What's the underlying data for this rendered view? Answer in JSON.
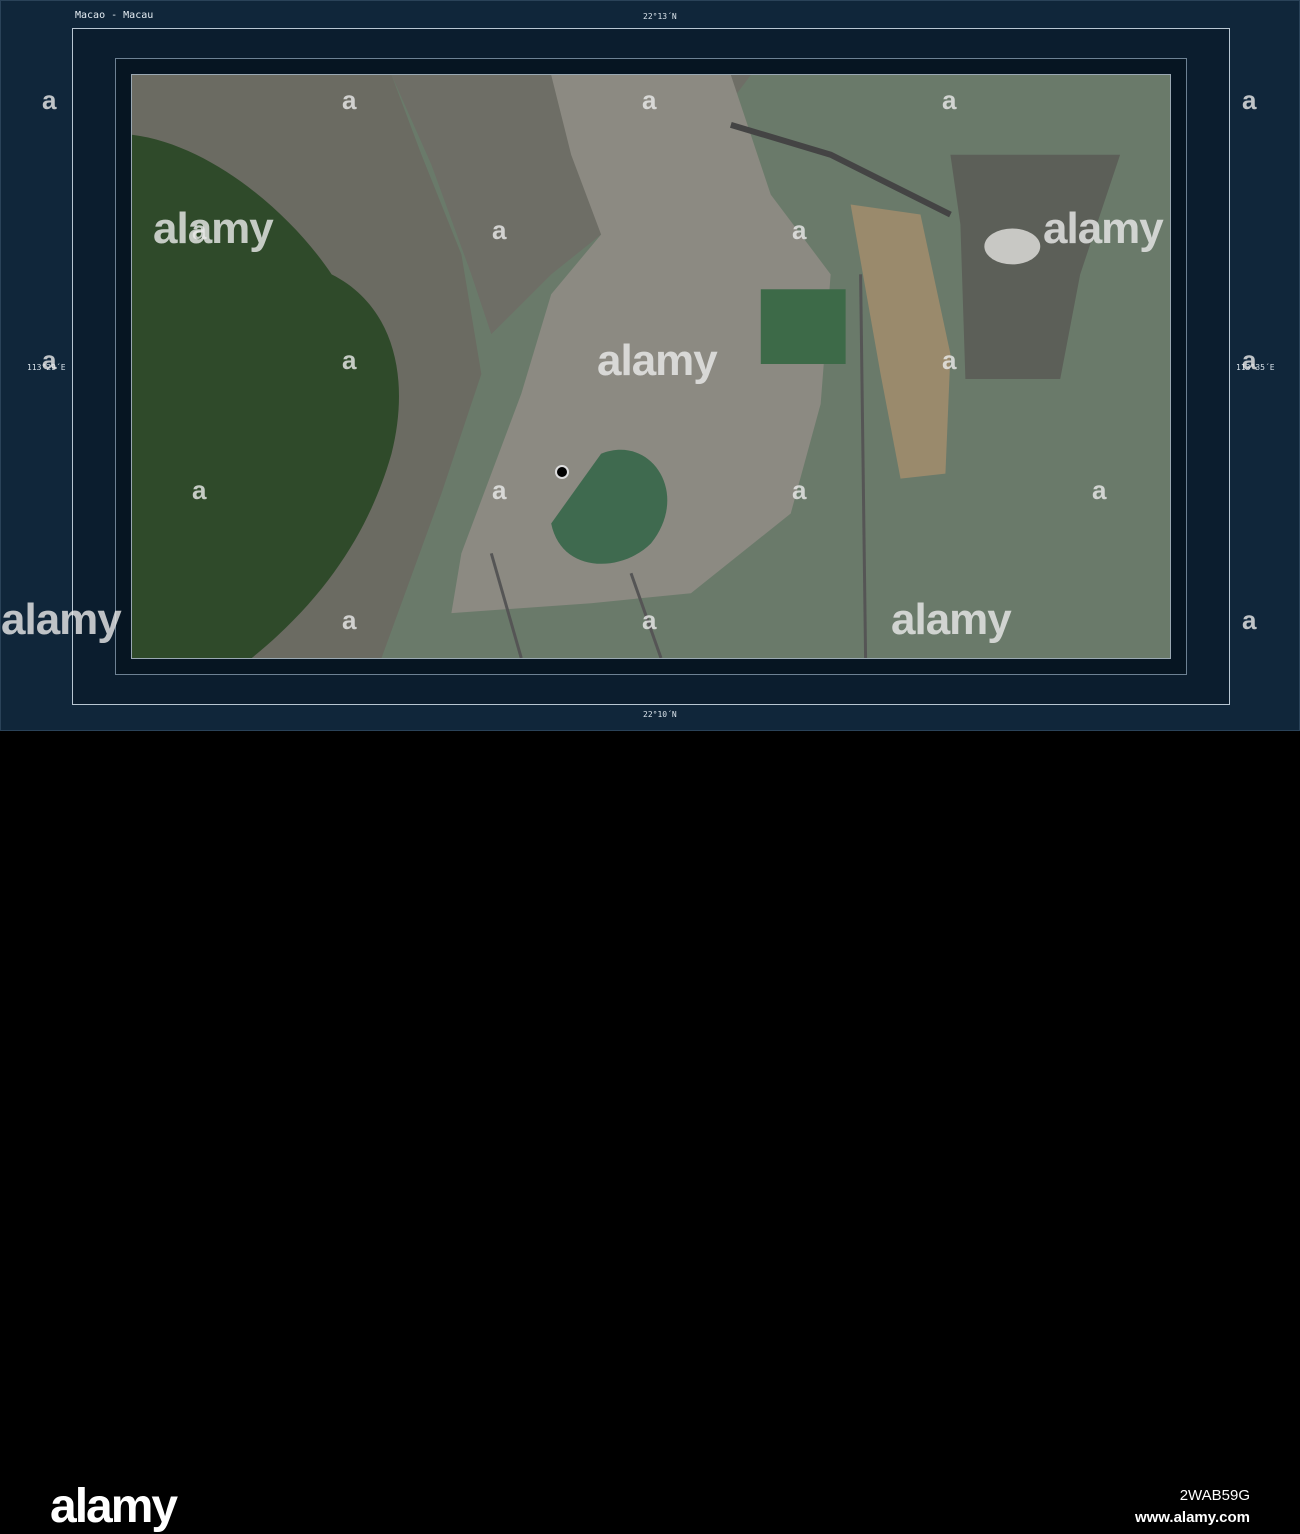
{
  "map": {
    "title": "Macao - Macau",
    "lat_top": "22°13´N",
    "lat_bottom": "22°10´N",
    "lon_left": "113°29´E",
    "lon_right": "113°35´E"
  },
  "watermark": {
    "text": "alamy",
    "letter": "a"
  },
  "banner": {
    "logo": "alamy",
    "image_code": "2WAB59G",
    "url": "www.alamy.com"
  },
  "colors": {
    "frame": "#10263a",
    "water": "#6a7f6e",
    "urban": "#8a8a84",
    "forest": "#2f4a2a"
  }
}
